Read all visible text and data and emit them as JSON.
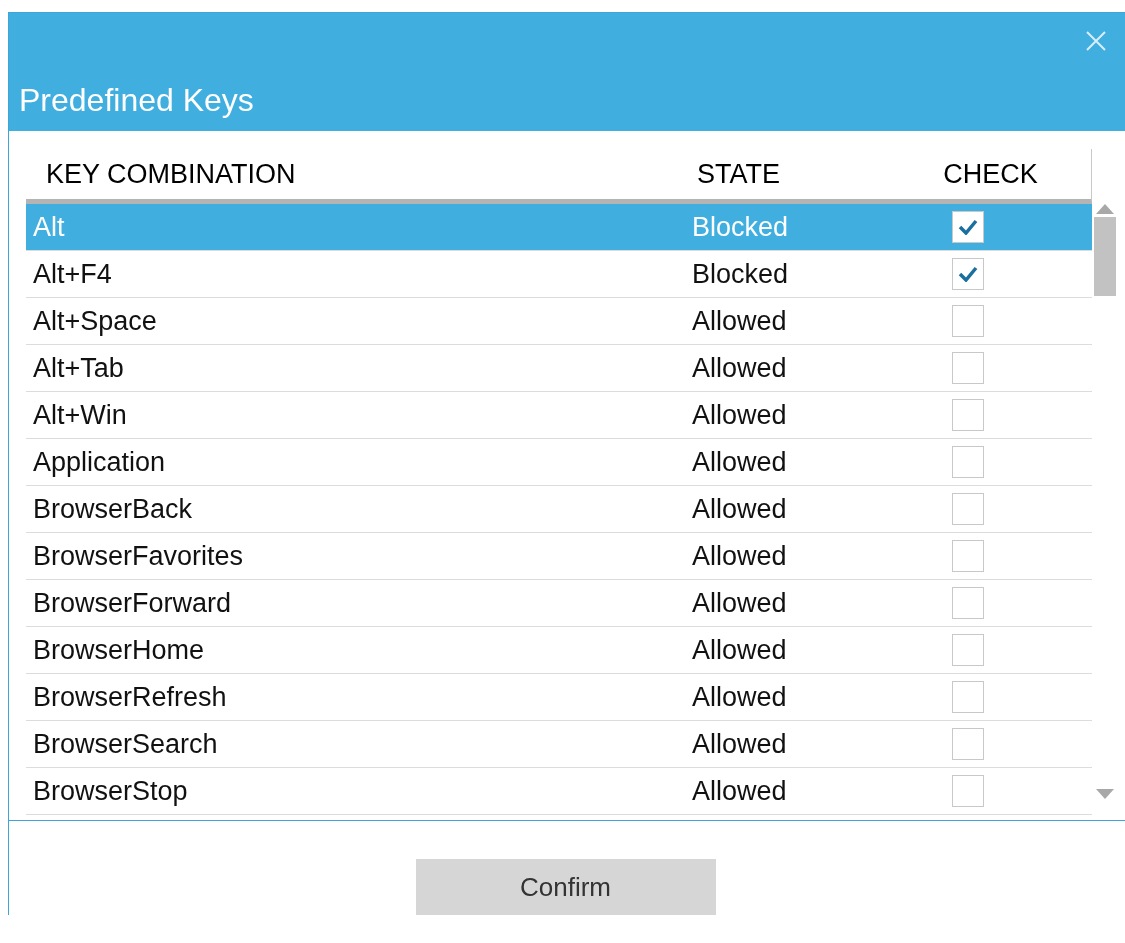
{
  "window": {
    "title": "Predefined Keys"
  },
  "table": {
    "columns": [
      "KEY COMBINATION",
      "STATE",
      "CHECK"
    ],
    "rows": [
      {
        "key": "Alt",
        "state": "Blocked",
        "checked": true,
        "selected": true
      },
      {
        "key": "Alt+F4",
        "state": "Blocked",
        "checked": true,
        "selected": false
      },
      {
        "key": "Alt+Space",
        "state": "Allowed",
        "checked": false,
        "selected": false
      },
      {
        "key": "Alt+Tab",
        "state": "Allowed",
        "checked": false,
        "selected": false
      },
      {
        "key": "Alt+Win",
        "state": "Allowed",
        "checked": false,
        "selected": false
      },
      {
        "key": "Application",
        "state": "Allowed",
        "checked": false,
        "selected": false
      },
      {
        "key": "BrowserBack",
        "state": "Allowed",
        "checked": false,
        "selected": false
      },
      {
        "key": "BrowserFavorites",
        "state": "Allowed",
        "checked": false,
        "selected": false
      },
      {
        "key": "BrowserForward",
        "state": "Allowed",
        "checked": false,
        "selected": false
      },
      {
        "key": "BrowserHome",
        "state": "Allowed",
        "checked": false,
        "selected": false
      },
      {
        "key": "BrowserRefresh",
        "state": "Allowed",
        "checked": false,
        "selected": false
      },
      {
        "key": "BrowserSearch",
        "state": "Allowed",
        "checked": false,
        "selected": false
      },
      {
        "key": "BrowserStop",
        "state": "Allowed",
        "checked": false,
        "selected": false
      }
    ]
  },
  "buttons": [
    "Confirm"
  ]
}
